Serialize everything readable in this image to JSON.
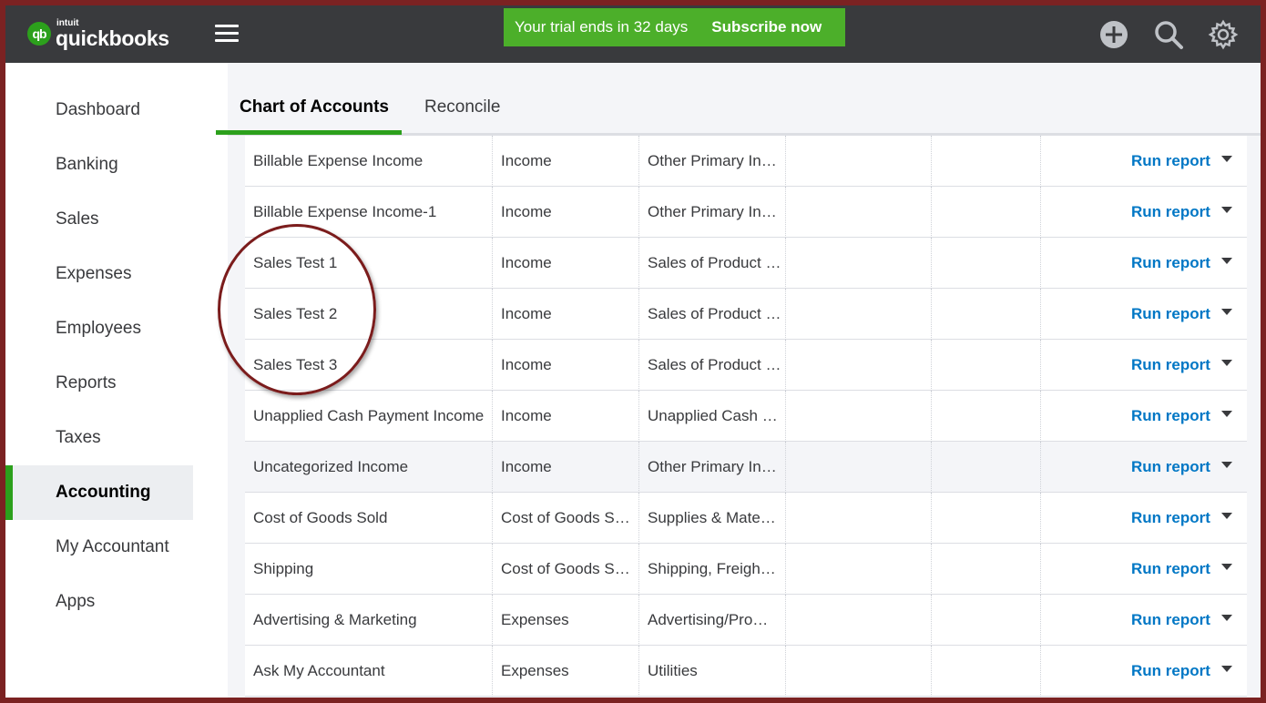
{
  "brand": {
    "logo_mark": "qb",
    "logo_intuit": "intuit",
    "logo_name": "quickbooks",
    "accent_color": "#2ca01c"
  },
  "topbar": {
    "trial_text": "Your trial ends in 32 days",
    "subscribe_label": "Subscribe now",
    "icons": [
      "plus-circle-icon",
      "search-icon",
      "gear-icon"
    ]
  },
  "sidebar": {
    "items": [
      {
        "label": "Dashboard"
      },
      {
        "label": "Banking"
      },
      {
        "label": "Sales"
      },
      {
        "label": "Expenses"
      },
      {
        "label": "Employees"
      },
      {
        "label": "Reports"
      },
      {
        "label": "Taxes"
      },
      {
        "label": "Accounting",
        "active": true
      },
      {
        "label": "My Accountant"
      },
      {
        "label": "Apps"
      }
    ]
  },
  "tabs": [
    {
      "label": "Chart of Accounts",
      "active": true
    },
    {
      "label": "Reconcile"
    }
  ],
  "accounts": [
    {
      "name": "Billable Expense Income",
      "type": "Income",
      "detail": "Other Primary In…",
      "action": "Run report"
    },
    {
      "name": "Billable Expense Income-1",
      "type": "Income",
      "detail": "Other Primary In…",
      "action": "Run report"
    },
    {
      "name": "Sales Test 1",
      "type": "Income",
      "detail": "Sales of Product …",
      "action": "Run report"
    },
    {
      "name": "Sales Test 2",
      "type": "Income",
      "detail": "Sales of Product …",
      "action": "Run report"
    },
    {
      "name": "Sales Test 3",
      "type": "Income",
      "detail": "Sales of Product …",
      "action": "Run report"
    },
    {
      "name": "Unapplied Cash Payment Income",
      "type": "Income",
      "detail": "Unapplied Cash …",
      "action": "Run report"
    },
    {
      "name": "Uncategorized Income",
      "type": "Income",
      "detail": "Other Primary In…",
      "action": "Run report",
      "highlighted": true
    },
    {
      "name": "Cost of Goods Sold",
      "type": "Cost of Goods S…",
      "detail": "Supplies & Mate…",
      "action": "Run report"
    },
    {
      "name": "Shipping",
      "type": "Cost of Goods S…",
      "detail": "Shipping, Freigh…",
      "action": "Run report"
    },
    {
      "name": "Advertising & Marketing",
      "type": "Expenses",
      "detail": "Advertising/Pro…",
      "action": "Run report"
    },
    {
      "name": "Ask My Accountant",
      "type": "Expenses",
      "detail": "Utilities",
      "action": "Run report"
    }
  ]
}
